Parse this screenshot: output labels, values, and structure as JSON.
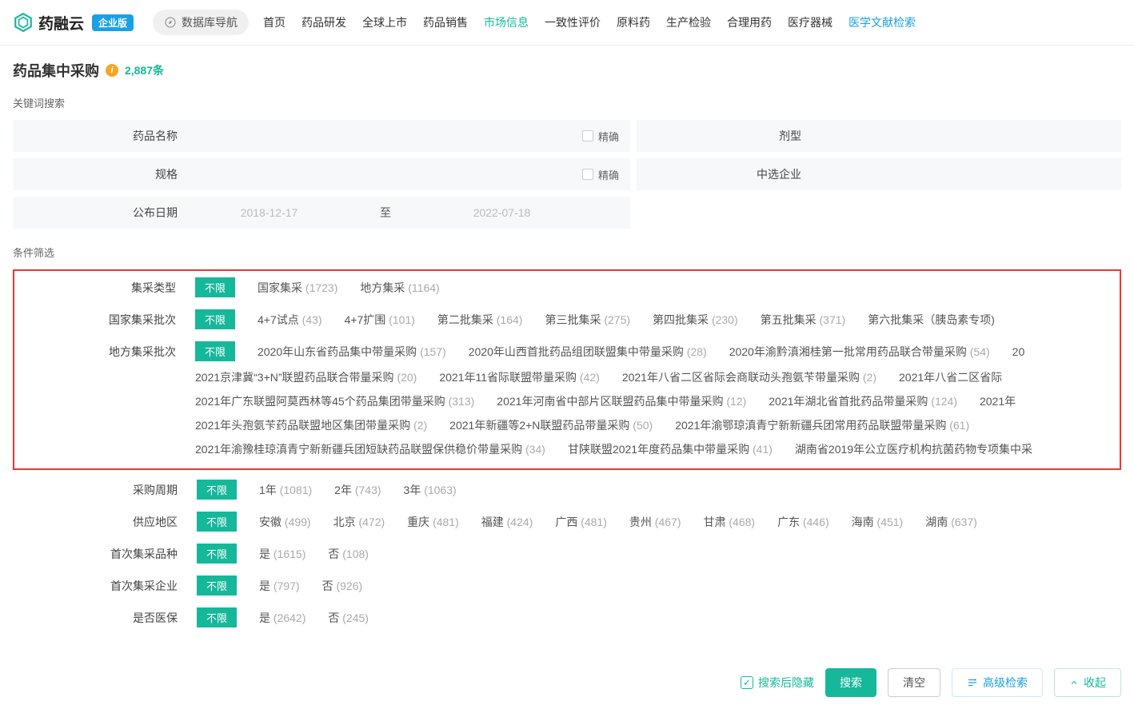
{
  "header": {
    "brand": "药融云",
    "badge": "企业版",
    "nav_button": "数据库导航",
    "menu": [
      "首页",
      "药品研发",
      "全球上市",
      "药品销售",
      "市场信息",
      "一致性评价",
      "原料药",
      "生产检验",
      "合理用药",
      "医疗器械",
      "医学文献检索"
    ],
    "active_idx": 4,
    "hl_idx": 10
  },
  "page": {
    "title": "药品集中采购",
    "count": "2,887条"
  },
  "search": {
    "section_label": "关键词搜索",
    "fields": {
      "drug_name": "药品名称",
      "dosage_form": "剂型",
      "spec": "规格",
      "winner": "中选企业",
      "date": "公布日期"
    },
    "precise": "精确",
    "date_from_ph": "2018-12-17",
    "date_sep": "至",
    "date_to_ph": "2022-07-18"
  },
  "filter": {
    "section_label": "条件筛选",
    "all": "不限",
    "rows": {
      "type": {
        "label": "集采类型",
        "opts": [
          [
            "国家集采",
            "1723"
          ],
          [
            "地方集采",
            "1164"
          ]
        ]
      },
      "nat": {
        "label": "国家集采批次",
        "opts": [
          [
            "4+7试点",
            "43"
          ],
          [
            "4+7扩围",
            "101"
          ],
          [
            "第二批集采",
            "164"
          ],
          [
            "第三批集采",
            "275"
          ],
          [
            "第四批集采",
            "230"
          ],
          [
            "第五批集采",
            "371"
          ],
          [
            "第六批集采（胰岛素专项)",
            ""
          ]
        ]
      },
      "loc": {
        "label": "地方集采批次",
        "opts": [
          [
            "2020年山东省药品集中带量采购",
            "157"
          ],
          [
            "2020年山西首批药品组团联盟集中带量采购",
            "28"
          ],
          [
            "2020年渝黔滇湘桂第一批常用药品联合带量采购",
            "54"
          ],
          [
            "20",
            ""
          ],
          [
            "2021京津冀“3+N”联盟药品联合带量采购",
            "20"
          ],
          [
            "2021年11省际联盟带量采购",
            "42"
          ],
          [
            "2021年八省二区省际会商联动头孢氨苄带量采购",
            "2"
          ],
          [
            "2021年八省二区省际",
            ""
          ],
          [
            "2021年广东联盟阿莫西林等45个药品集团带量采购",
            "313"
          ],
          [
            "2021年河南省中部片区联盟药品集中带量采购",
            "12"
          ],
          [
            "2021年湖北省首批药品带量采购",
            "124"
          ],
          [
            "2021年",
            ""
          ],
          [
            "2021年头孢氨苄药品联盟地区集团带量采购",
            "2"
          ],
          [
            "2021年新疆等2+N联盟药品带量采购",
            "50"
          ],
          [
            "2021年渝鄂琼滇青宁新新疆兵团常用药品联盟带量采购",
            "61"
          ],
          [
            "2021年渝豫桂琼滇青宁新新疆兵团短缺药品联盟保供稳价带量采购",
            "34"
          ],
          [
            "甘陕联盟2021年度药品集中带量采购",
            "41"
          ],
          [
            "湖南省2019年公立医疗机构抗菌药物专项集中采",
            ""
          ]
        ]
      },
      "cycle": {
        "label": "采购周期",
        "opts": [
          [
            "1年",
            "1081"
          ],
          [
            "2年",
            "743"
          ],
          [
            "3年",
            "1063"
          ]
        ]
      },
      "region": {
        "label": "供应地区",
        "opts": [
          [
            "安徽",
            "499"
          ],
          [
            "北京",
            "472"
          ],
          [
            "重庆",
            "481"
          ],
          [
            "福建",
            "424"
          ],
          [
            "广西",
            "481"
          ],
          [
            "贵州",
            "467"
          ],
          [
            "甘肃",
            "468"
          ],
          [
            "广东",
            "446"
          ],
          [
            "海南",
            "451"
          ],
          [
            "湖南",
            "637"
          ]
        ]
      },
      "first_var": {
        "label": "首次集采品种",
        "opts": [
          [
            "是",
            "1615"
          ],
          [
            "否",
            "108"
          ]
        ]
      },
      "first_ent": {
        "label": "首次集采企业",
        "opts": [
          [
            "是",
            "797"
          ],
          [
            "否",
            "926"
          ]
        ]
      },
      "insured": {
        "label": "是否医保",
        "opts": [
          [
            "是",
            "2642"
          ],
          [
            "否",
            "245"
          ]
        ]
      }
    }
  },
  "footer": {
    "hide_after": "搜索后隐藏",
    "search": "搜索",
    "clear": "清空",
    "adv": "高级检索",
    "collapse": "收起"
  }
}
